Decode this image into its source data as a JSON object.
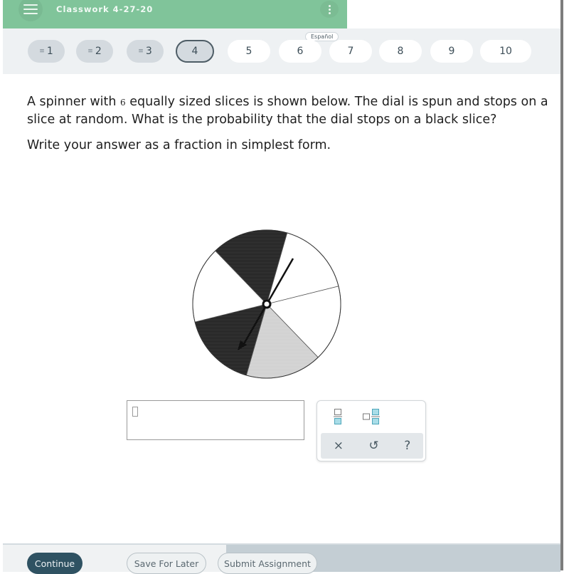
{
  "header": {
    "title": "Classwork 4-27-20",
    "menu_icon": "hamburger-menu-icon",
    "more_icon": "vertical-dots-icon",
    "colors": {
      "bar": "#80c49a",
      "nav_bg": "#eef1f3"
    }
  },
  "nav": {
    "language_label": "Español",
    "questions": [
      {
        "label": "1",
        "state": "answered"
      },
      {
        "label": "2",
        "state": "answered"
      },
      {
        "label": "3",
        "state": "answered"
      },
      {
        "label": "4",
        "state": "current"
      },
      {
        "label": "5",
        "state": "unanswered"
      },
      {
        "label": "6",
        "state": "unanswered"
      },
      {
        "label": "7",
        "state": "unanswered"
      },
      {
        "label": "8",
        "state": "unanswered"
      },
      {
        "label": "9",
        "state": "unanswered"
      },
      {
        "label": "10",
        "state": "unanswered"
      }
    ],
    "answered_marker": "≡"
  },
  "question": {
    "text_before_num": "A spinner with ",
    "slice_count": "6",
    "text_after_num": " equally sized slices is shown below. The dial is spun and stops on a slice at random. What is the probability that the dial stops on a black slice?",
    "instruction": "Write your answer as a fraction in simplest form."
  },
  "spinner": {
    "slices": [
      {
        "color": "white"
      },
      {
        "color": "white"
      },
      {
        "color": "gray"
      },
      {
        "color": "black"
      },
      {
        "color": "white"
      },
      {
        "color": "black"
      }
    ],
    "colors": {
      "white": "#ffffff",
      "gray": "#d6d6d6",
      "black": "#2a2a2a"
    }
  },
  "answer": {
    "value": "",
    "keypad": {
      "fraction_icon": "fraction-icon",
      "mixed_number_icon": "mixed-number-icon",
      "clear_label": "×",
      "undo_label": "↺",
      "help_label": "?"
    }
  },
  "footer": {
    "continue_label": "Continue",
    "save_label": "Save For Later",
    "submit_label": "Submit Assignment"
  }
}
